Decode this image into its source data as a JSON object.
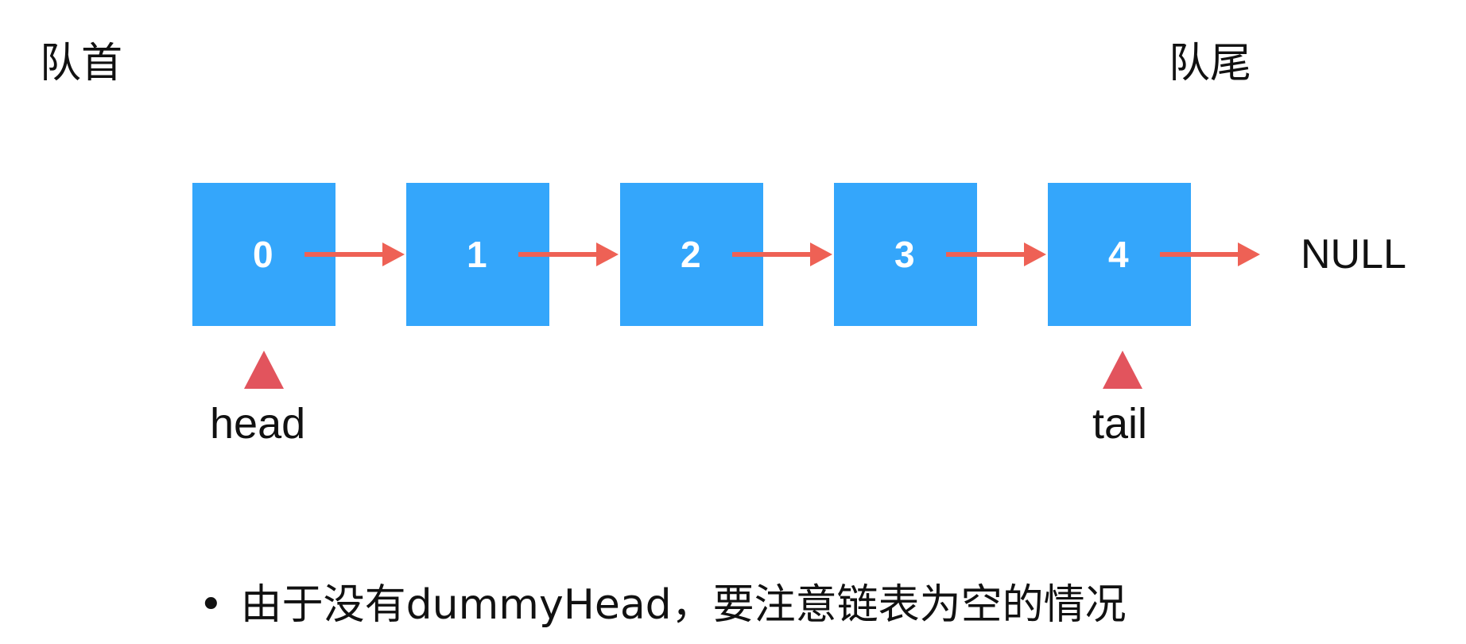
{
  "labels": {
    "queue_head": "队首",
    "queue_tail": "队尾",
    "null": "NULL",
    "head": "head",
    "tail": "tail"
  },
  "nodes": [
    {
      "value": "0"
    },
    {
      "value": "1"
    },
    {
      "value": "2"
    },
    {
      "value": "3"
    },
    {
      "value": "4"
    }
  ],
  "note": {
    "bullet": "•",
    "text": "由于没有dummyHead，要注意链表为空的情况"
  },
  "colors": {
    "node_fill": "#34a6fb",
    "node_text": "#ffffff",
    "arrow": "#ee6155",
    "pointer": "#e2545d",
    "text": "#111111",
    "background": "#ffffff"
  }
}
